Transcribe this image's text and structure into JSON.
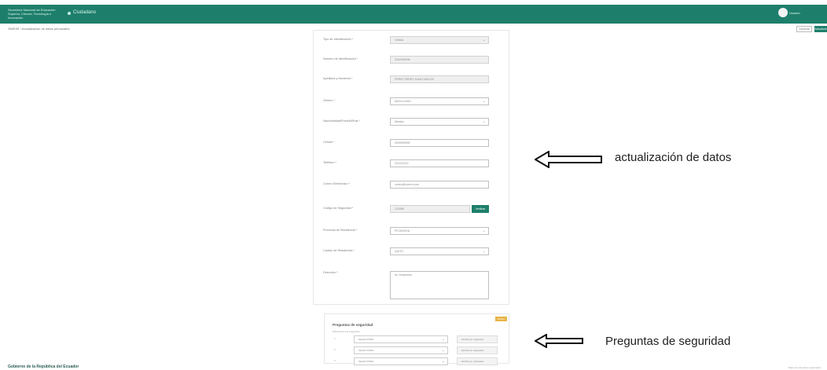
{
  "header": {
    "brand": "Secretaría Nacional de Educación Superior, Ciencia, Tecnología e Innovación",
    "app_name": "Ciudadano",
    "user_name": "Usuario"
  },
  "subheader": {
    "breadcrumb": "SNIESE / Actualización de datos personales",
    "cancel_label": "Cancelar",
    "update_label": "Actualizar"
  },
  "form": {
    "fields": [
      {
        "label": "Tipo de Identificación *",
        "value": "Cédula"
      },
      {
        "label": "Número de Identificación *",
        "value": "0102030405"
      },
      {
        "label": "Apellidos y Nombres *",
        "value": "PEREZ PEREZ JUAN CARLOS"
      },
      {
        "label": "Género *",
        "value": "MASCULINO"
      },
      {
        "label": "Nacionalidad/Pueblo/Etnia *",
        "value": "Mestizo"
      },
      {
        "label": "Celular *",
        "value": "0999999999"
      },
      {
        "label": "Teléfono *",
        "value": "022222222"
      },
      {
        "label": "Correo Electrónico *",
        "value": "correo@correo.com"
      },
      {
        "label": "Código de Seguridad *",
        "value": "123456",
        "button": "Verificar"
      },
      {
        "label": "Provincia de Residencia *",
        "value": "PICHINCHA"
      },
      {
        "label": "Cantón de Residencia *",
        "value": "QUITO"
      }
    ],
    "address": {
      "label": "Dirección *",
      "value": "Av. Amazonas"
    }
  },
  "security": {
    "badge": "Nuevo",
    "title": "Preguntas de seguridad",
    "note": "Seleccione sus preguntas",
    "rows": [
      {
        "number": "1",
        "question": "SELECCIONE",
        "answer": "Escriba su respuesta"
      },
      {
        "number": "2",
        "question": "SELECCIONE",
        "answer": "Escriba su respuesta"
      },
      {
        "number": "3",
        "question": "SELECCIONE",
        "answer": "Escriba su respuesta"
      }
    ]
  },
  "annotations": {
    "update_data": "actualización de datos",
    "security_questions": "Preguntas de seguridad"
  },
  "footer": {
    "left": "Gobierno de la República del Ecuador",
    "right": "Todos los derechos reservados"
  },
  "colors": {
    "brand": "#1d7f6b",
    "badge": "#e8b448"
  },
  "icons": {
    "user": "user-avatar-icon",
    "dropdown": "chevron-down-icon",
    "arrow": "left-arrow-icon"
  }
}
